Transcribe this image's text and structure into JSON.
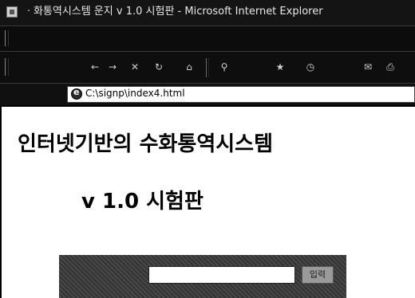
{
  "window": {
    "title": "ㆍ화통역시스템 운지 v 1.0 시험판 - Microsoft Internet Explorer"
  },
  "address_bar": {
    "url": "C:\\signp\\index4.html"
  },
  "page": {
    "heading": "인터넷기반의 수화통역시스템",
    "version": "v 1.0 시험판"
  },
  "form": {
    "input_value": "",
    "button_label": "입력"
  },
  "icons": {
    "title": "ie-window-icon",
    "toolbar": [
      "back-arrow-icon",
      "forward-arrow-icon",
      "stop-icon",
      "refresh-icon",
      "home-icon",
      "search-icon",
      "favorites-icon",
      "history-icon",
      "mail-icon",
      "print-icon",
      "edit-icon"
    ],
    "address": "ie-page-icon"
  }
}
